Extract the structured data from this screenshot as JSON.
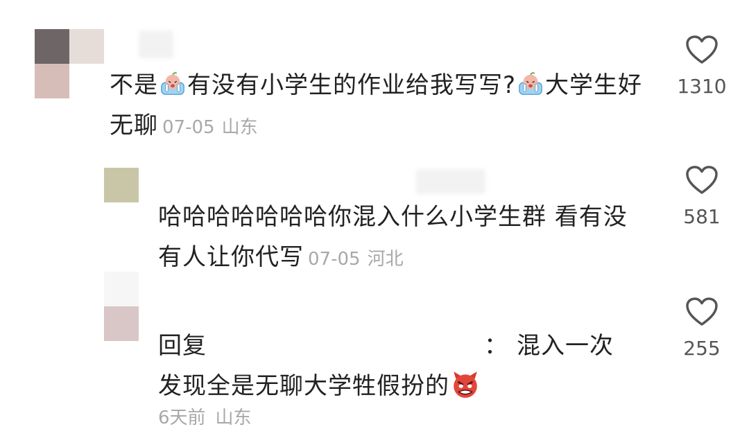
{
  "comments": [
    {
      "text_before": "不是",
      "text_middle": "有没有小学生的作业给我写写?",
      "text_after": "大学生好无聊",
      "date": "07-05",
      "location": "山东",
      "likes": "1310",
      "emoji": "crying-baby-emoji"
    },
    {
      "text": "哈哈哈哈哈哈哈你混入什么小学生群 看有没有人让你代写",
      "date": "07-05",
      "location": "河北",
      "likes": "581"
    },
    {
      "reply_prefix": "回复",
      "reply_colon": "：",
      "text_a": "混入一次",
      "text_b": "发现全是无聊大学牲假扮的",
      "time": "6天前",
      "location": "山东",
      "likes": "255",
      "emoji": "angry-devil-emoji"
    }
  ],
  "colors": {
    "text": "#222222",
    "meta": "#a8a8a8",
    "heart_stroke": "#555555"
  }
}
